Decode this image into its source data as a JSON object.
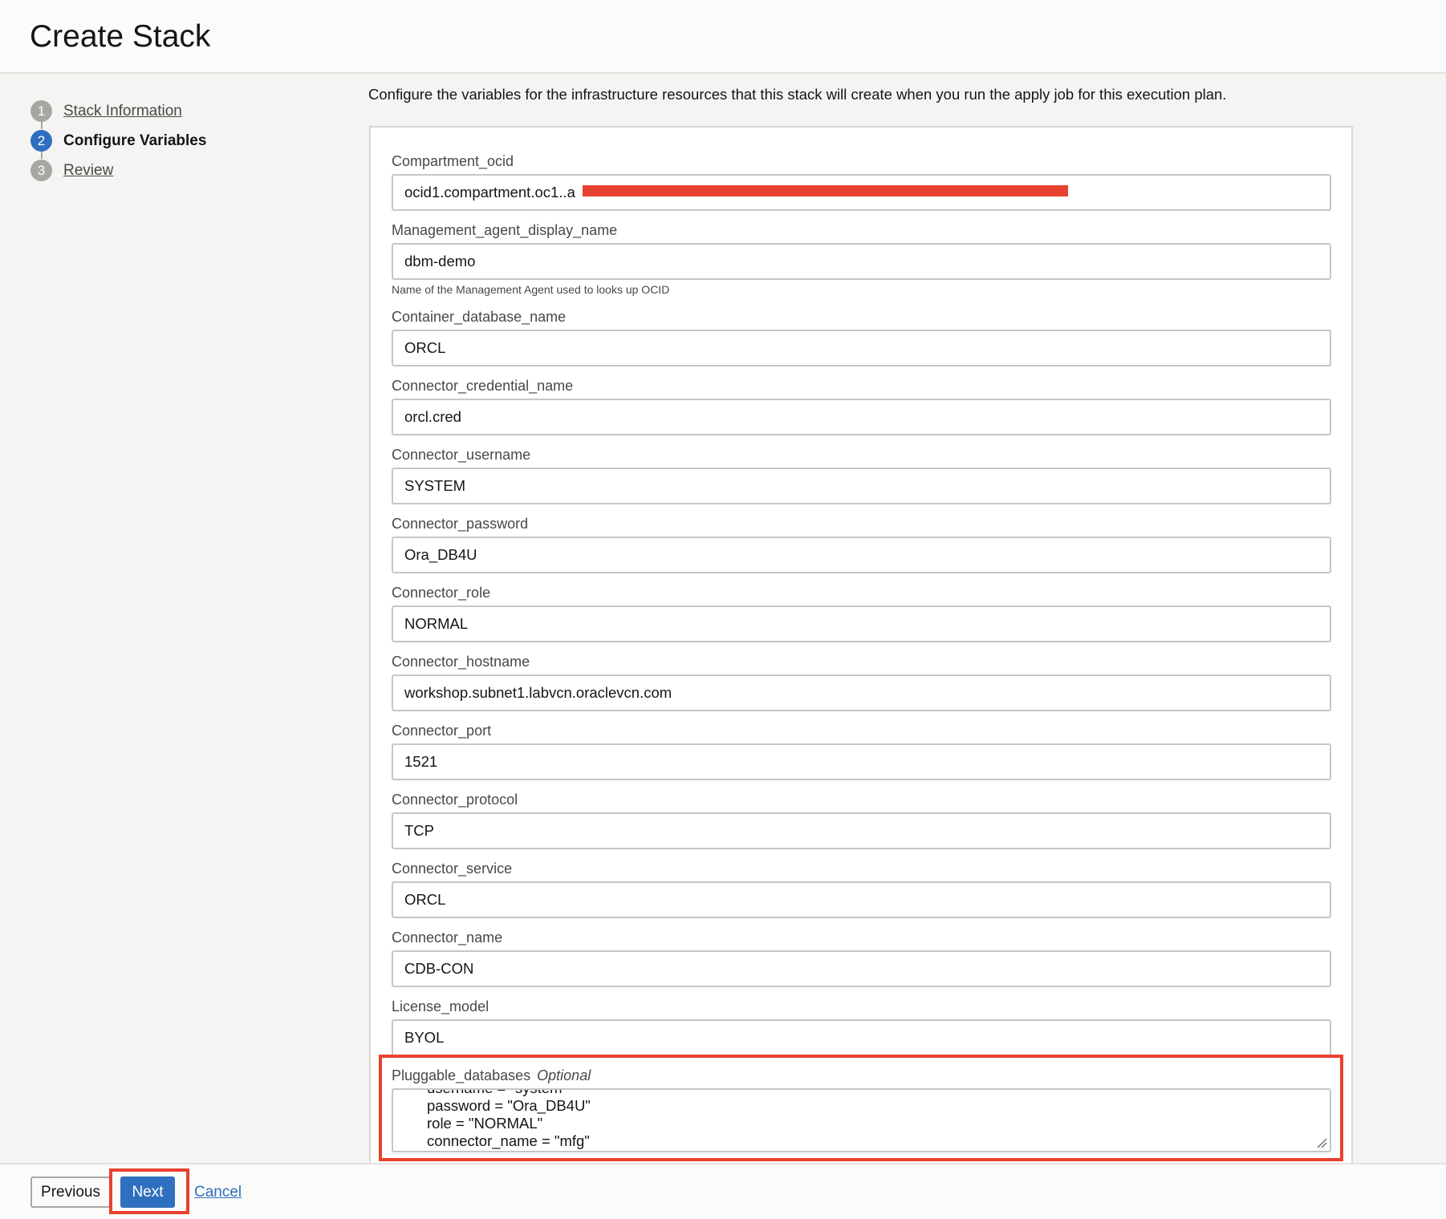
{
  "header": {
    "title": "Create Stack"
  },
  "steps": [
    {
      "number": "1",
      "label": "Stack Information",
      "state": "link"
    },
    {
      "number": "2",
      "label": "Configure Variables",
      "state": "active"
    },
    {
      "number": "3",
      "label": "Review",
      "state": "link"
    }
  ],
  "intro": "Configure the variables for the infrastructure resources that this stack will create when you run the apply job for this execution plan.",
  "fields": {
    "compartment_ocid": {
      "label": "Compartment_ocid",
      "value": "ocid1.compartment.oc1..a"
    },
    "management_agent_display_name": {
      "label": "Management_agent_display_name",
      "value": "dbm-demo",
      "help": "Name of the Management Agent used to looks up OCID"
    },
    "container_database_name": {
      "label": "Container_database_name",
      "value": "ORCL"
    },
    "connector_credential_name": {
      "label": "Connector_credential_name",
      "value": "orcl.cred"
    },
    "connector_username": {
      "label": "Connector_username",
      "value": "SYSTEM"
    },
    "connector_password": {
      "label": "Connector_password",
      "value": "Ora_DB4U"
    },
    "connector_role": {
      "label": "Connector_role",
      "value": "NORMAL"
    },
    "connector_hostname": {
      "label": "Connector_hostname",
      "value": "workshop.subnet1.labvcn.oraclevcn.com"
    },
    "connector_port": {
      "label": "Connector_port",
      "value": "1521"
    },
    "connector_protocol": {
      "label": "Connector_protocol",
      "value": "TCP"
    },
    "connector_service": {
      "label": "Connector_service",
      "value": "ORCL"
    },
    "connector_name": {
      "label": "Connector_name",
      "value": "CDB-CON"
    },
    "license_model": {
      "label": "License_model",
      "value": "BYOL"
    },
    "pluggable_databases": {
      "label": "Pluggable_databases",
      "optional": "Optional",
      "value": "username = \"system\"\npassword = \"Ora_DB4U\"\nrole = \"NORMAL\"\nconnector_name = \"mfg\"\n},"
    }
  },
  "footer": {
    "previous": "Previous",
    "next": "Next",
    "cancel": "Cancel"
  },
  "colors": {
    "accent": "#2f6fbf",
    "highlight": "#e8412f",
    "redaction": "#e8412f"
  }
}
